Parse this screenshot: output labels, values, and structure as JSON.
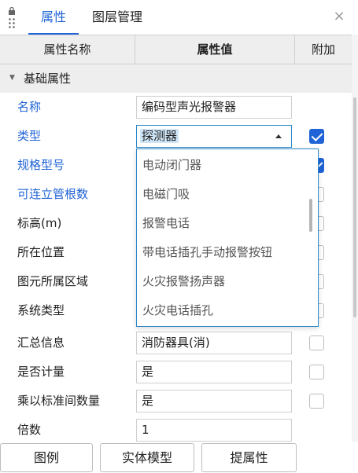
{
  "tabs": [
    {
      "label": "属性",
      "active": true
    },
    {
      "label": "图层管理",
      "active": false
    }
  ],
  "close_glyph": "×",
  "columns": {
    "name": "属性名称",
    "value": "属性值",
    "extra": "附加"
  },
  "group": {
    "label": "基础属性"
  },
  "properties": [
    {
      "name": "名称",
      "value": "编码型声光报警器",
      "checkbox": null
    },
    {
      "name": "类型",
      "value": "探测器",
      "checkbox": true
    },
    {
      "name": "规格型号",
      "value": "",
      "checkbox": true
    },
    {
      "name": "可连立管根数",
      "value": "",
      "checkbox": false
    },
    {
      "name": "标高(m)",
      "value": "",
      "checkbox": false
    },
    {
      "name": "所在位置",
      "value": "",
      "checkbox": false
    },
    {
      "name": "图元所属区域",
      "value": "",
      "checkbox": false
    },
    {
      "name": "系统类型",
      "value": "",
      "checkbox": false
    },
    {
      "name": "汇总信息",
      "value": "消防器具(消)",
      "checkbox": false
    },
    {
      "name": "是否计量",
      "value": "是",
      "checkbox": false
    },
    {
      "name": "乘以标准间数量",
      "value": "是",
      "checkbox": false
    },
    {
      "name": "倍数",
      "value": "1",
      "checkbox": null
    }
  ],
  "dropdown_options": [
    "电动闭门器",
    "电磁门吸",
    "报警电话",
    "带电话插孔手动报警按钮",
    "火灾报警扬声器",
    "火灾电话插孔"
  ],
  "buttons": {
    "legend": "图例",
    "model": "实体模型",
    "extract": "提属性"
  },
  "colors": {
    "accent": "#1f63d6",
    "dropdown_border": "#2b87c9"
  }
}
